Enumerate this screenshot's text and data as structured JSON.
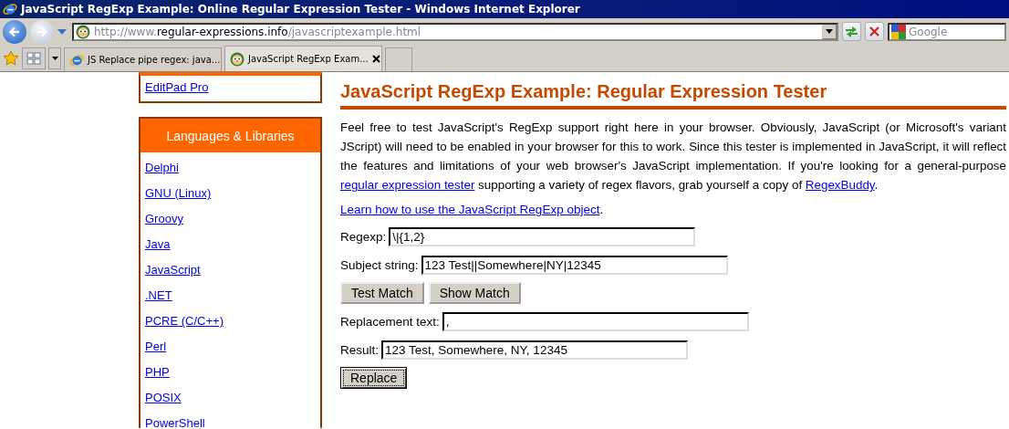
{
  "window": {
    "title": "JavaScript RegExp Example: Online Regular Expression Tester - Windows Internet Explorer"
  },
  "address_bar": {
    "prefix": "http://www.",
    "domain": "regular-expressions.info",
    "path": "/javascriptexample.html"
  },
  "search": {
    "placeholder": "Google"
  },
  "tabs": [
    {
      "label": "JS Replace pipe regex: java...",
      "selected": false,
      "kind": "ie"
    },
    {
      "label": "JavaScript RegExp Exam...",
      "selected": true,
      "kind": "site"
    }
  ],
  "sidebar": {
    "top_box": {
      "items": [
        "EditPad Pro"
      ]
    },
    "languages": {
      "heading": "Languages & Libraries",
      "items": [
        "Delphi",
        "GNU (Linux)",
        "Groovy",
        "Java",
        "JavaScript",
        ".NET",
        "PCRE (C/C++)",
        "Perl",
        "PHP",
        "POSIX",
        "PowerShell"
      ]
    }
  },
  "main": {
    "heading": "JavaScript RegExp Example: Regular Expression Tester",
    "intro": [
      {
        "kind": "text",
        "text": "Feel free to test JavaScript's RegExp support right here in your browser. Obviously, JavaScript (or Microsoft's variant JScript) will need to be enabled in your browser for this to work. Since this tester is implemented in JavaScript, it will reflect the features and limitations of your web browser's JavaScript implementation. If you're looking for a general-purpose "
      },
      {
        "kind": "link",
        "text": "regular expression tester"
      },
      {
        "kind": "text",
        "text": " supporting a variety of regex flavors, grab yourself a copy of "
      },
      {
        "kind": "link",
        "text": "RegexBuddy"
      },
      {
        "kind": "text",
        "text": "."
      }
    ],
    "learn_link": "Learn how to use the JavaScript RegExp object",
    "learn_suffix": ".",
    "form": [
      {
        "kind": "field",
        "label": "Regexp:",
        "value": "\\|{1,2}"
      },
      {
        "kind": "field",
        "label": "Subject string:",
        "value": "123 Test||Somewhere|NY|12345"
      },
      {
        "kind": "buttons",
        "buttons": [
          {
            "label": "Test Match",
            "focused": false
          },
          {
            "label": "Show Match",
            "focused": false
          }
        ]
      },
      {
        "kind": "field",
        "label": "Replacement text:",
        "value": ","
      },
      {
        "kind": "field",
        "label": "Result:",
        "value": "123 Test, Somewhere, NY, 12345"
      },
      {
        "kind": "buttons",
        "buttons": [
          {
            "label": "Replace",
            "focused": true
          }
        ]
      }
    ]
  }
}
